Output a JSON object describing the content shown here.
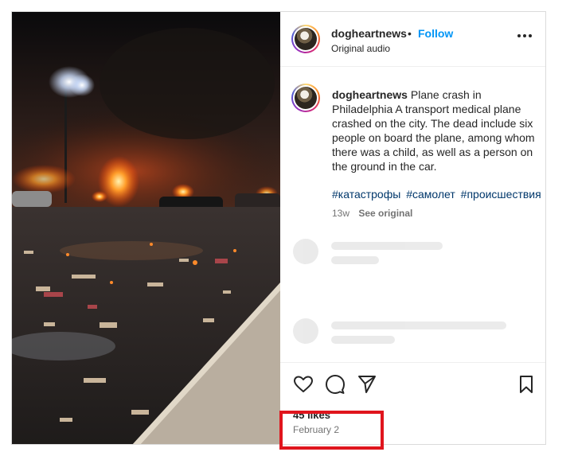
{
  "header": {
    "username": "dogheartnews",
    "separator": "•",
    "follow_label": "Follow",
    "audio_label": "Original audio",
    "more_icon": "more-horizontal-icon"
  },
  "caption": {
    "username": "dogheartnews",
    "text": "Plane crash in Philadelphia A transport medical plane crashed on the city. The dead include six people on board the plane, among whom there was a child, as well as a person on the ground in the car.",
    "hashtags": [
      "#катастрофы",
      "#самолет",
      "#происшествия"
    ],
    "time_ago": "13w",
    "see_original_label": "See original"
  },
  "actions": {
    "icons": [
      "heart-icon",
      "comment-icon",
      "share-icon",
      "bookmark-icon"
    ],
    "likes": "45 likes",
    "date": "February 2"
  },
  "media": {
    "description_icon": "video-frame"
  },
  "colors": {
    "accent": "#0095f6",
    "hashtag": "#00376b",
    "annotation": "#e0151d",
    "muted": "#737373"
  }
}
